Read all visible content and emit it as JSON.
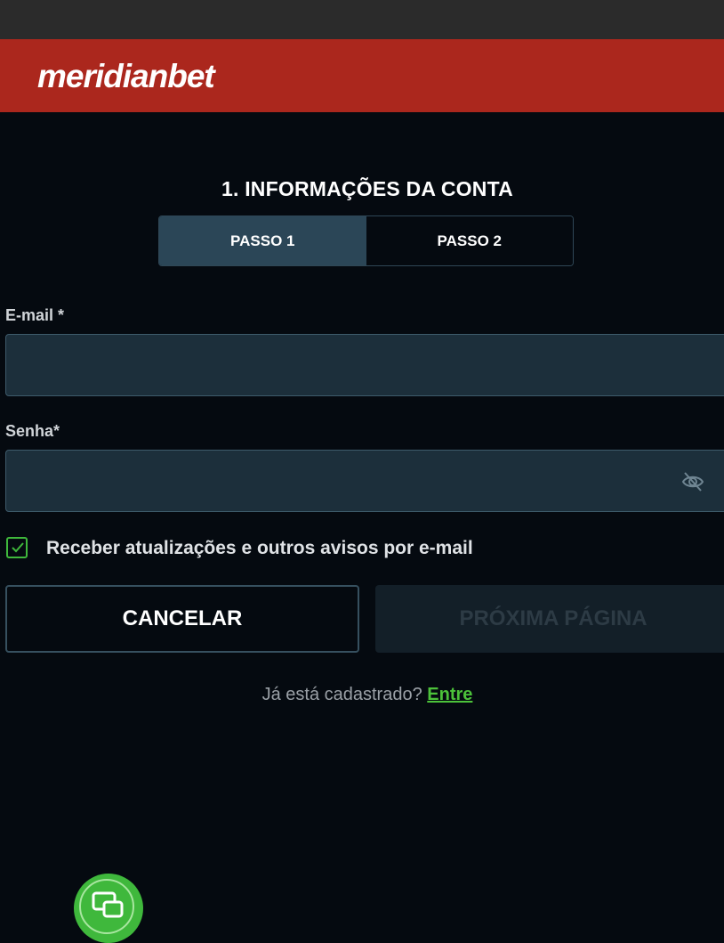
{
  "header": {
    "logo_text": "meridianbet"
  },
  "form": {
    "title": "1. INFORMAÇÕES DA CONTA",
    "steps": [
      {
        "label": "PASSO 1",
        "active": true
      },
      {
        "label": "PASSO 2",
        "active": false
      }
    ],
    "email": {
      "label": "E-mail *",
      "value": "",
      "placeholder": ""
    },
    "password": {
      "label": "Senha*",
      "value": "",
      "placeholder": ""
    },
    "newsletter": {
      "label": "Receber atualizações e outros avisos por e-mail",
      "checked": true
    },
    "cancel_label": "CANCELAR",
    "next_label": "PRÓXIMA PÁGINA",
    "login_prompt": "Já está cadastrado?",
    "login_link": "Entre"
  },
  "icons": {
    "password_toggle": "eye-off-icon",
    "checkbox_check": "checkmark-icon",
    "chat": "chat-icon"
  },
  "colors": {
    "header_red": "#ab271d",
    "background": "#050a10",
    "active_tab": "#2b4657",
    "input_bg": "#1c2f3b",
    "accent_green": "#3fb83c",
    "link_green": "#4cc23a",
    "disabled_text": "#2d3b45"
  }
}
